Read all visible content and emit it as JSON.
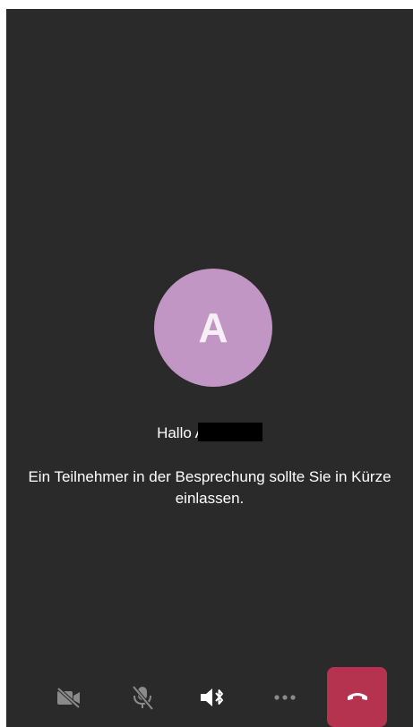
{
  "call": {
    "avatar_initial": "A",
    "greeting_text": "Hallo A",
    "lobby_message": "Ein Teilnehmer in der Besprechung sollte Sie in Kürze einlassen."
  },
  "toolbar": {
    "camera": {
      "icon": "camera-off-icon",
      "state": "off"
    },
    "microphone": {
      "icon": "microphone-off-icon",
      "state": "off"
    },
    "speaker": {
      "icon": "bluetooth-speaker-icon",
      "state": "on"
    },
    "more": {
      "icon": "more-icon"
    },
    "hangup": {
      "icon": "hang-up-icon"
    }
  },
  "colors": {
    "background": "#2a2a2a",
    "avatar": "#c195c4",
    "hangup": "#b5334e",
    "icon_disabled": "#8a8a8a",
    "icon_active": "#ffffff"
  }
}
